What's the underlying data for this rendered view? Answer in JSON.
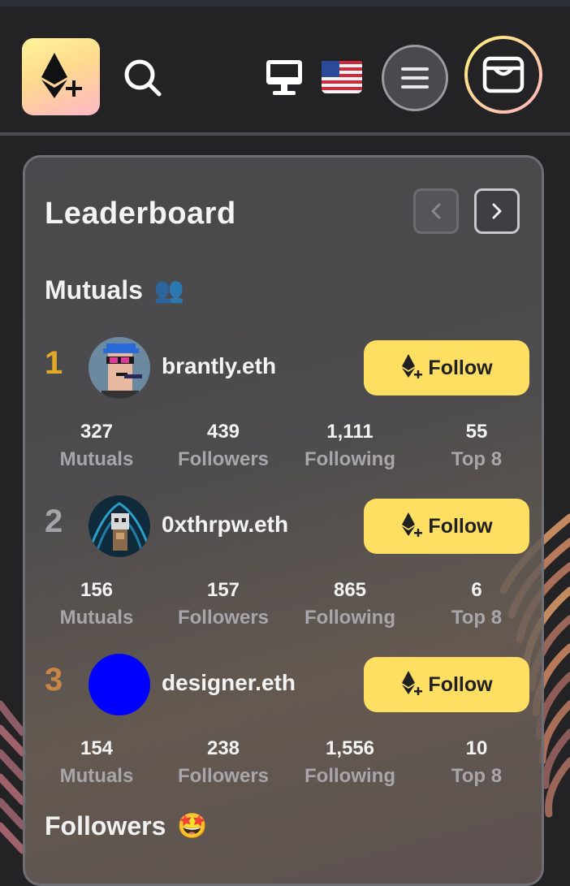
{
  "header": {
    "logo_icon": "ethereum-plus-icon",
    "search_icon": "search-icon",
    "monitor_icon": "monitor-icon",
    "language_flag": "us-flag-icon",
    "menu_icon": "hamburger-menu-icon",
    "wallet_icon": "wallet-icon"
  },
  "leaderboard": {
    "title": "Leaderboard",
    "prev_icon": "chevron-left-icon",
    "next_icon": "chevron-right-icon",
    "mutuals_section": {
      "label": "Mutuals",
      "emoji": "👥"
    },
    "followers_section": {
      "label": "Followers",
      "emoji": "🤩"
    },
    "follow_label": "Follow",
    "stat_labels": [
      "Mutuals",
      "Followers",
      "Following",
      "Top 8"
    ],
    "rows": [
      {
        "rank": "1",
        "rank_color": "#e2a828",
        "name": "brantly.eth",
        "avatar": "punk-avatar",
        "stats": [
          "327",
          "439",
          "1,111",
          "55"
        ]
      },
      {
        "rank": "2",
        "rank_color": "#a4a4a8",
        "name": "0xthrpw.eth",
        "avatar": "robot-avatar",
        "stats": [
          "156",
          "157",
          "865",
          "6"
        ]
      },
      {
        "rank": "3",
        "rank_color": "#c98546",
        "name": "designer.eth",
        "avatar": "blue-circle-avatar",
        "stats": [
          "154",
          "238",
          "1,556",
          "10"
        ]
      }
    ]
  },
  "colors": {
    "accent": "#ffdf62",
    "background": "#232325"
  }
}
